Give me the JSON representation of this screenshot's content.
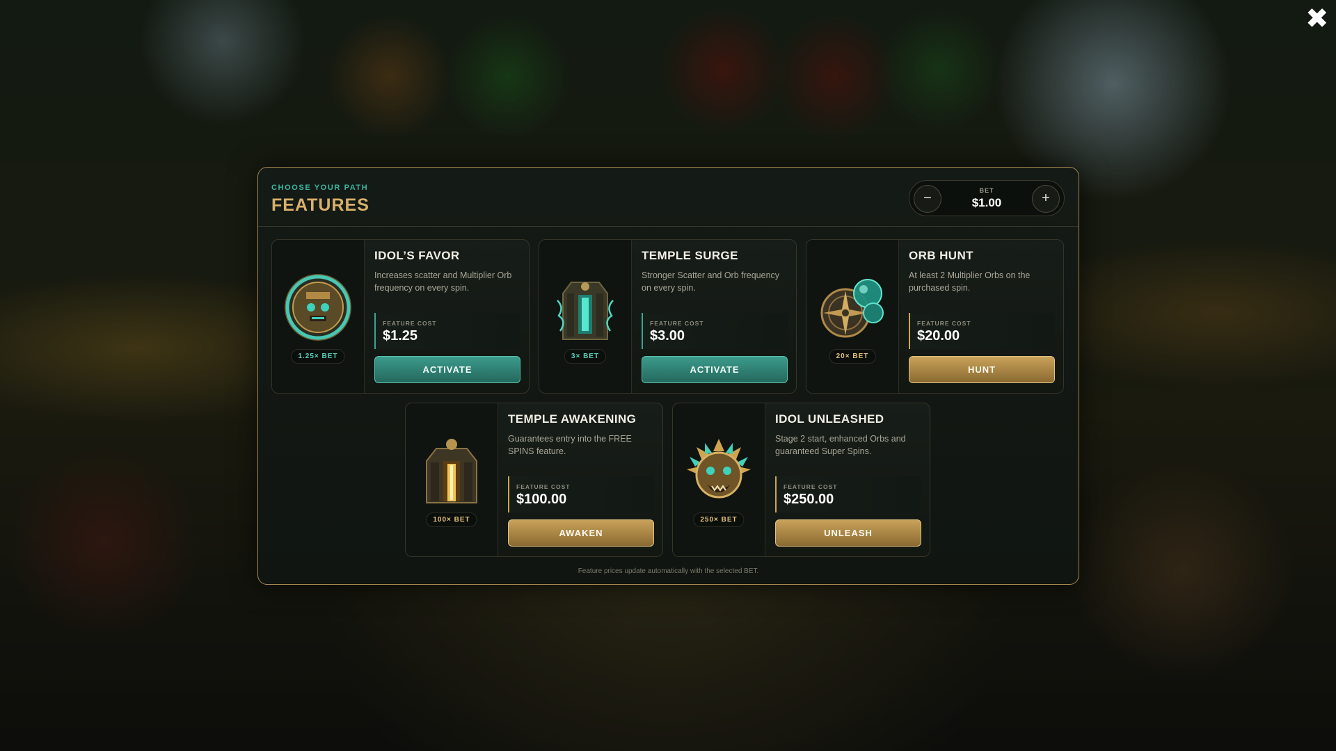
{
  "modal": {
    "kicker": "CHOOSE YOUR PATH",
    "title": "FEATURES",
    "bet": {
      "label": "BET",
      "value": "$1.00",
      "minus": "−",
      "plus": "+"
    },
    "footer": "Feature prices update automatically with the selected BET."
  },
  "close_icon": "✖",
  "cost_label": "FEATURE COST",
  "features": [
    {
      "title": "IDOL’S FAVOR",
      "desc": "Increases scatter and Multiplier Orb frequency on every spin.",
      "multiplier": "1.25× BET",
      "cost": "$1.25",
      "action": "ACTIVATE",
      "style": "teal",
      "icon": "idol-disc-icon"
    },
    {
      "title": "TEMPLE SURGE",
      "desc": "Stronger Scatter and Orb frequency on every spin.",
      "multiplier": "3× BET",
      "cost": "$3.00",
      "action": "ACTIVATE",
      "style": "teal",
      "icon": "temple-surge-icon"
    },
    {
      "title": "ORB HUNT",
      "desc": "At least 2 Multiplier Orbs on the purchased spin.",
      "multiplier": "20× BET",
      "cost": "$20.00",
      "action": "HUNT",
      "style": "gold",
      "icon": "compass-orb-icon"
    },
    {
      "title": "TEMPLE AWAKENING",
      "desc": "Guarantees entry into the FREE SPINS feature.",
      "multiplier": "100× BET",
      "cost": "$100.00",
      "action": "AWAKEN",
      "style": "gold",
      "icon": "temple-gate-icon"
    },
    {
      "title": "IDOL UNLEASHED",
      "desc": "Stage 2 start, enhanced Orbs and guaranteed Super Spins.",
      "multiplier": "250× BET",
      "cost": "$250.00",
      "action": "UNLEASH",
      "style": "gold",
      "icon": "idol-mask-icon"
    }
  ],
  "colors": {
    "accent_teal": "#3fb6a2",
    "accent_gold": "#d9b16a",
    "teal_badge": "#57d3bd",
    "gold_badge": "#e6c27d"
  }
}
